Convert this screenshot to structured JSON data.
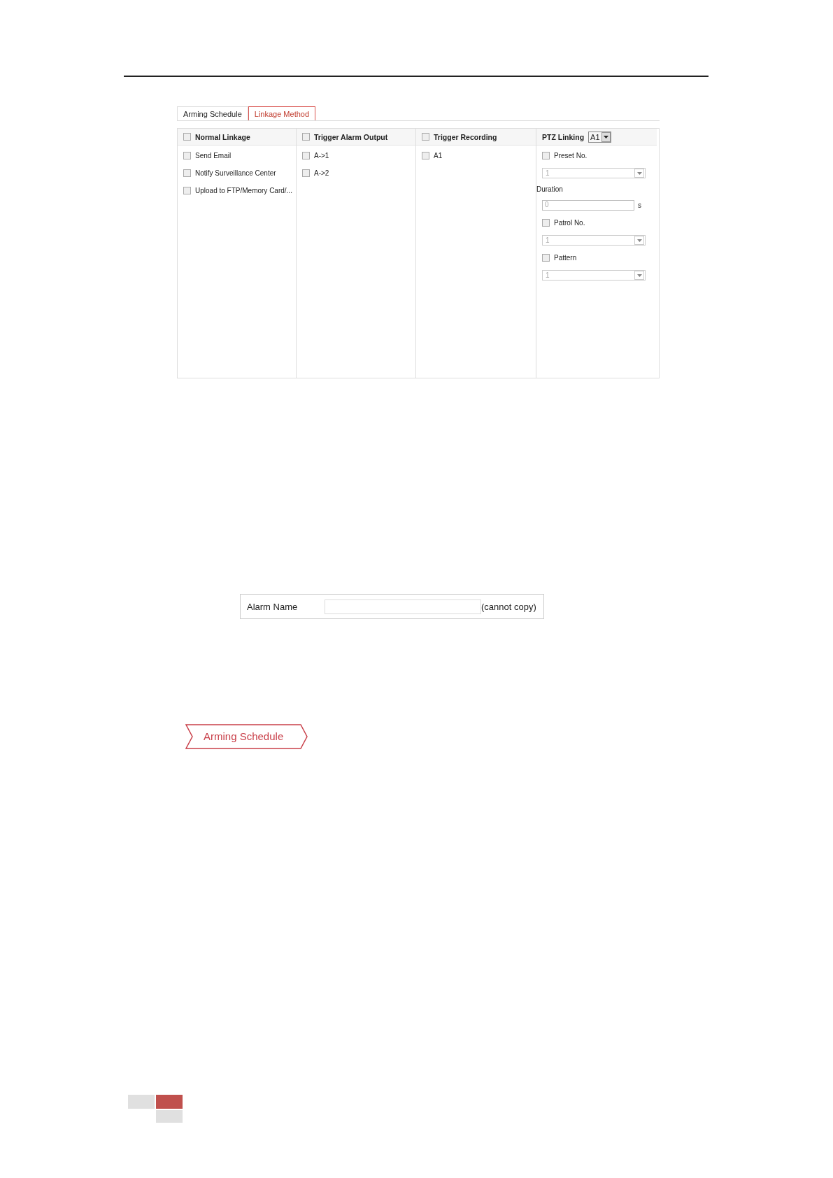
{
  "tabs": [
    {
      "label": "Arming Schedule",
      "selected": false
    },
    {
      "label": "Linkage Method",
      "selected": true
    }
  ],
  "columns": [
    {
      "kind": "checklist",
      "title": "Normal Linkage",
      "checked": false,
      "items": [
        {
          "label": "Send Email",
          "checked": false
        },
        {
          "label": "Notify Surveillance Center",
          "checked": false
        },
        {
          "label": "Upload to FTP/Memory Card/...",
          "checked": false
        }
      ]
    },
    {
      "kind": "checklist",
      "title": "Trigger Alarm Output",
      "checked": false,
      "items": [
        {
          "label": "A->1",
          "checked": false
        },
        {
          "label": "A->2",
          "checked": false
        }
      ]
    },
    {
      "kind": "checklist",
      "title": "Trigger Recording",
      "checked": false,
      "items": [
        {
          "label": "A1",
          "checked": false
        }
      ]
    },
    {
      "kind": "ptz",
      "title": "PTZ Linking",
      "select_value": "A1",
      "items": [
        {
          "kind": "checkbox",
          "label": "Preset No.",
          "checked": false
        },
        {
          "kind": "select",
          "value": "1"
        },
        {
          "kind": "label",
          "label": "Duration"
        },
        {
          "kind": "input",
          "value": "0",
          "unit": "s"
        },
        {
          "kind": "checkbox",
          "label": "Patrol No.",
          "checked": false
        },
        {
          "kind": "select",
          "value": "1"
        },
        {
          "kind": "checkbox",
          "label": "Pattern",
          "checked": false
        },
        {
          "kind": "select",
          "value": "1"
        }
      ]
    }
  ],
  "alarm_name": {
    "label": "Alarm Name",
    "note": "(cannot copy)"
  },
  "arming_schedule_tab": {
    "label": "Arming Schedule"
  }
}
